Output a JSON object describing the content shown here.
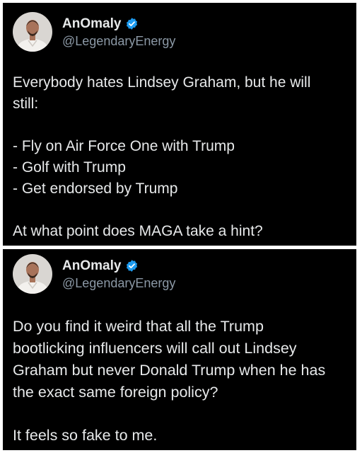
{
  "tweets": [
    {
      "author": {
        "display_name": "AnOmaly",
        "handle": "@LegendaryEnergy",
        "verified_icon": "verified-badge-icon",
        "avatar_icon": "avatar"
      },
      "lines": [
        "Everybody hates Lindsey Graham, but he will",
        "still:",
        "",
        "- Fly on Air Force One with Trump",
        "- Golf with Trump",
        "- Get endorsed by Trump",
        "",
        "At what point does MAGA take a hint?"
      ]
    },
    {
      "author": {
        "display_name": "AnOmaly",
        "handle": "@LegendaryEnergy",
        "verified_icon": "verified-badge-icon",
        "avatar_icon": "avatar"
      },
      "lines": [
        "Do you find it weird that all the Trump",
        "bootlicking influencers will call out Lindsey",
        "Graham but never Donald Trump when he has",
        "the exact same foreign policy?",
        "",
        "It feels so fake to me."
      ]
    }
  ],
  "colors": {
    "background": "#000000",
    "text": "#e7e9ea",
    "handle": "#8b98a5",
    "verified": "#1d9bf0"
  }
}
